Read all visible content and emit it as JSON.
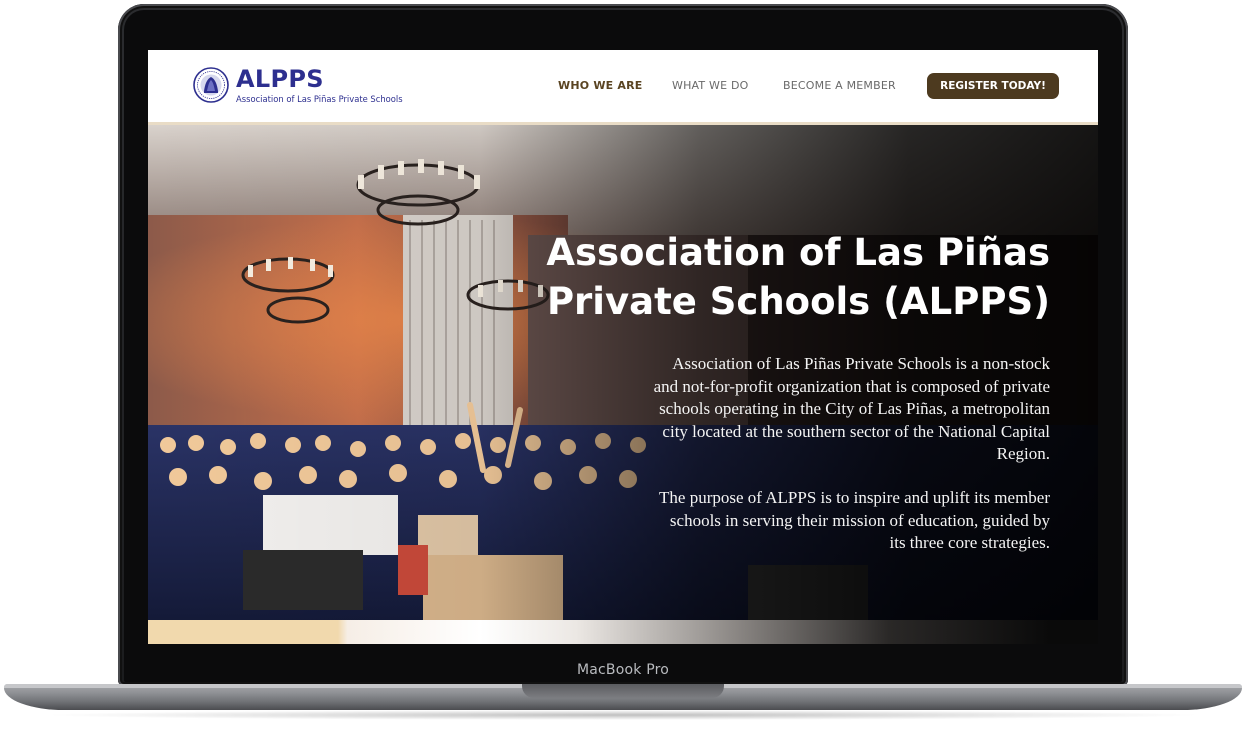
{
  "device": {
    "label": "MacBook Pro"
  },
  "site": {
    "logo_title": "ALPPS",
    "logo_subtitle": "Association of Las Piñas Private Schools"
  },
  "nav": {
    "items": [
      {
        "label": "WHO WE ARE",
        "active": true
      },
      {
        "label": "WHAT WE DO",
        "active": false
      },
      {
        "label": "BECOME A MEMBER",
        "active": false
      }
    ],
    "cta_label": "REGISTER TODAY!"
  },
  "hero": {
    "title_line1": "Association of Las Piñas",
    "title_line2": "Private Schools (ALPPS)",
    "paragraph1": "Association of Las Piñas Private Schools is a non-stock and not-for-profit organization that is composed of private schools operating in the City of Las Piñas, a metropolitan city located at the southern sector of the National Capital Region.",
    "paragraph2": "The purpose of ALPPS is to inspire and uplift its member schools in serving their mission of education, guided by its three core strategies."
  },
  "colors": {
    "brand_blue": "#2d2f8f",
    "nav_active": "#5a4422",
    "cta_bg": "#4d3a1f",
    "nav_border": "#e9dcc6"
  }
}
